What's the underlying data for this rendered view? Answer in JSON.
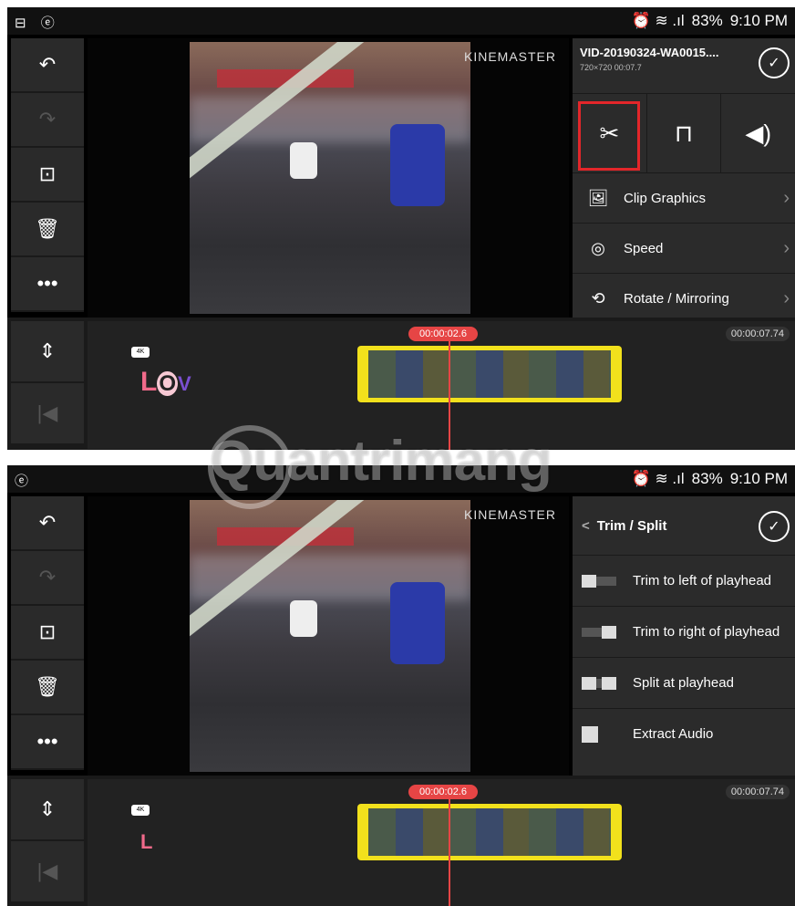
{
  "status": {
    "top_left_icons": "⊟ ⓔ",
    "bottom_left_icons": "ⓔ",
    "signal": "⏰ ≋ .ıl",
    "battery": "83%",
    "time": "9:10 PM"
  },
  "toolbar": {
    "undo": "↶",
    "redo": "↷",
    "fit": "⊡",
    "delete": "🗑",
    "more": "•••"
  },
  "preview": {
    "brand": "KINEMASTER"
  },
  "clip_panel": {
    "filename": "VID-20190324-WA0015....",
    "meta": "720×720 00:07.7",
    "confirm": "✓",
    "icons": [
      "✂",
      "⊓",
      "◀)"
    ],
    "items": [
      {
        "icon": "🖼",
        "label": "Clip Graphics",
        "arrow": "›"
      },
      {
        "icon": "◎",
        "label": "Speed",
        "arrow": "›"
      },
      {
        "icon": "⟲",
        "label": "Rotate / Mirroring",
        "arrow": "›"
      }
    ]
  },
  "trim_panel": {
    "back": "<",
    "title": "Trim / Split",
    "confirm": "✓",
    "items": [
      {
        "label": "Trim to left of playhead"
      },
      {
        "label": "Trim to right of playhead"
      },
      {
        "label": "Split at playhead"
      },
      {
        "label": "Extract Audio"
      }
    ]
  },
  "timeline": {
    "playhead_time": "00:00:02.6",
    "end_time": "00:00:07.74",
    "side_top": "⇕",
    "side_bottom": "|◀",
    "badge": "4K",
    "layer_text_top": [
      "L",
      "O",
      "V"
    ],
    "layer_text_bottom": "L"
  },
  "watermark": "Quantrimang"
}
